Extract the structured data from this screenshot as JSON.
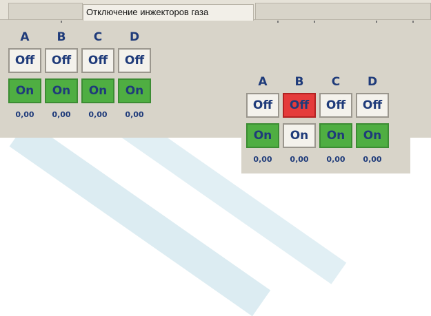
{
  "tab_title": "Отключение инжекторов газа",
  "panel1": {
    "columns": [
      "A",
      "B",
      "C",
      "D"
    ],
    "off_label": "Off",
    "on_label": "On",
    "values": [
      "0,00",
      "0,00",
      "0,00",
      "0,00"
    ],
    "off_active": [
      false,
      false,
      false,
      false
    ],
    "on_active": [
      true,
      true,
      true,
      true
    ]
  },
  "panel2": {
    "columns": [
      "A",
      "B",
      "C",
      "D"
    ],
    "off_label": "Off",
    "on_label": "On",
    "values": [
      "0,00",
      "0,00",
      "0,00",
      "0,00"
    ],
    "off_active": [
      false,
      true,
      false,
      false
    ],
    "on_active": [
      true,
      false,
      true,
      true
    ]
  },
  "colors": {
    "off_active_bg": "#e53b3b",
    "on_active_bg": "#4fae42",
    "label_color": "#1f3b7a",
    "panel_bg": "#d8d4c9"
  }
}
